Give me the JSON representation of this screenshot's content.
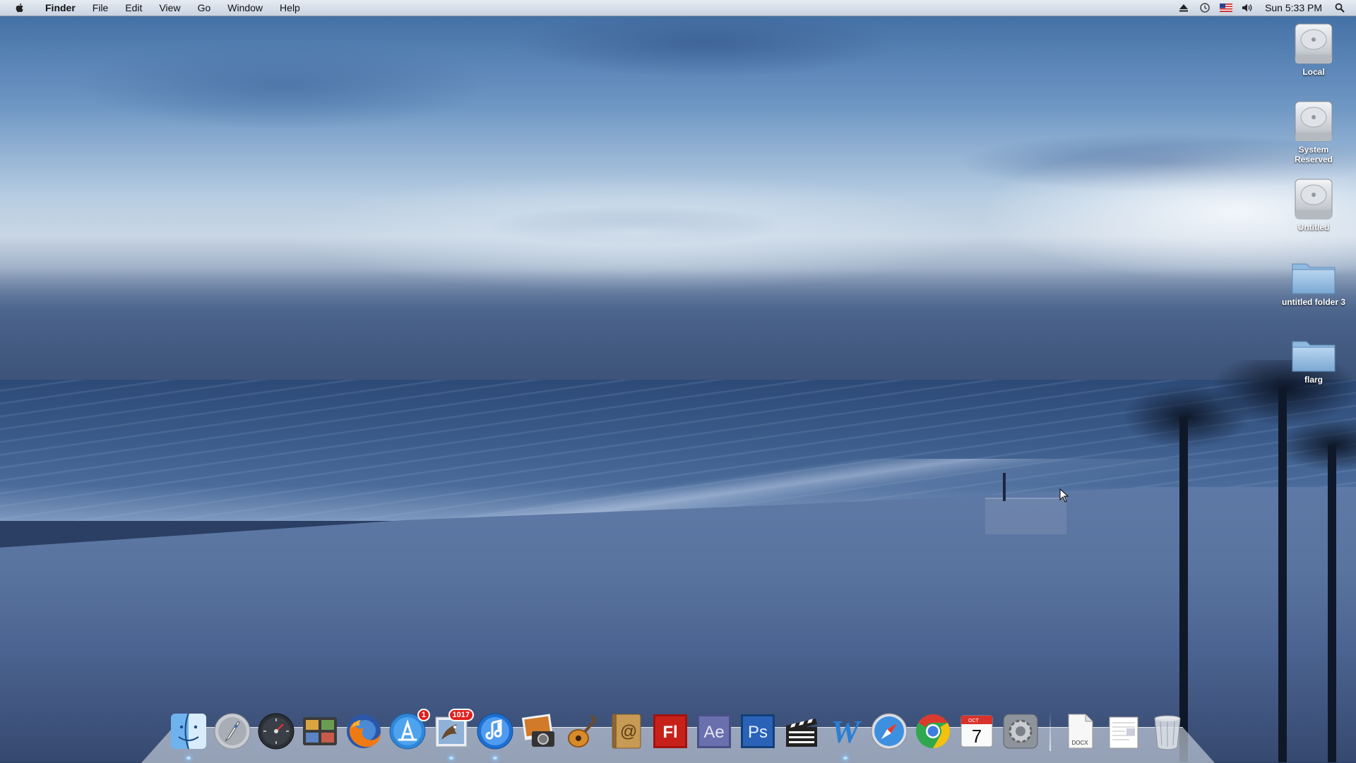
{
  "menubar": {
    "app_name": "Finder",
    "items": [
      "File",
      "Edit",
      "View",
      "Go",
      "Window",
      "Help"
    ],
    "clock": "Sun 5:33 PM",
    "status_icons": [
      "eject-icon",
      "time-machine-icon",
      "us-flag-input-icon",
      "volume-icon",
      "spotlight-icon"
    ]
  },
  "desktop": {
    "icons": [
      {
        "label": "Local",
        "kind": "hard-drive"
      },
      {
        "label": "System Reserved",
        "kind": "hard-drive"
      },
      {
        "label": "Untitled",
        "kind": "hard-drive"
      },
      {
        "label": "untitled folder 3",
        "kind": "folder"
      },
      {
        "label": "flarg",
        "kind": "folder"
      }
    ]
  },
  "dock": {
    "apps": [
      {
        "name": "finder-icon",
        "running": true
      },
      {
        "name": "launchpad-icon",
        "running": false
      },
      {
        "name": "dashboard-icon",
        "running": false
      },
      {
        "name": "photo-browser-icon",
        "running": false
      },
      {
        "name": "firefox-icon",
        "running": false
      },
      {
        "name": "app-store-icon",
        "running": false,
        "badge": "1"
      },
      {
        "name": "mail-icon",
        "running": true,
        "badge": "1017"
      },
      {
        "name": "itunes-icon",
        "running": true
      },
      {
        "name": "iphoto-icon",
        "running": false
      },
      {
        "name": "garageband-icon",
        "running": false
      },
      {
        "name": "address-book-icon",
        "running": false
      },
      {
        "name": "flash-icon",
        "running": false,
        "letters": "Fl"
      },
      {
        "name": "after-effects-icon",
        "running": false,
        "letters": "Ae"
      },
      {
        "name": "photoshop-icon",
        "running": false,
        "letters": "Ps"
      },
      {
        "name": "final-cut-icon",
        "running": false
      },
      {
        "name": "word-icon",
        "running": true,
        "letters": "W"
      },
      {
        "name": "safari-icon",
        "running": false
      },
      {
        "name": "chrome-icon",
        "running": false
      },
      {
        "name": "ical-icon",
        "running": false,
        "month": "OCT",
        "day": "7"
      },
      {
        "name": "system-preferences-icon",
        "running": false
      }
    ],
    "docs": [
      {
        "name": "docx-document-icon",
        "label": "DOCX"
      },
      {
        "name": "document-stack-icon"
      },
      {
        "name": "trash-icon"
      }
    ]
  },
  "colors": {
    "menubar_bg": "#e6ebf2",
    "badge_red": "#e0201e",
    "folder_blue": "#8fb9de"
  }
}
